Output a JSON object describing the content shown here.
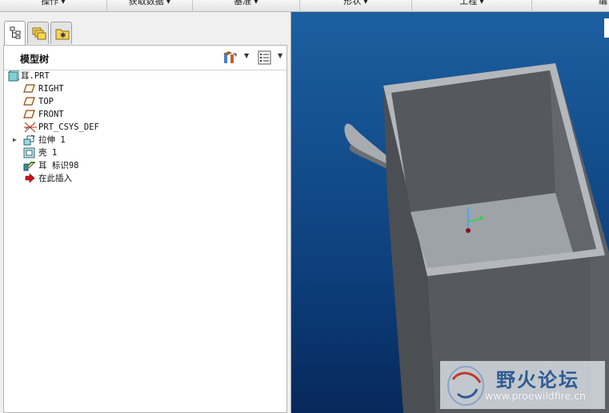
{
  "ribbon": {
    "groups": [
      {
        "label": "操作"
      },
      {
        "label": "获取数据"
      },
      {
        "label": "基准"
      },
      {
        "label": "形状"
      },
      {
        "label": "工程"
      },
      {
        "label": "编"
      }
    ]
  },
  "tabs": [
    {
      "icon": "model-tree-tab-icon",
      "active": true
    },
    {
      "icon": "layers-tab-icon",
      "active": false
    },
    {
      "icon": "folder-tab-icon",
      "active": false
    }
  ],
  "tree": {
    "title": "模型树",
    "settings_icon": "tree-settings-icon",
    "columns_icon": "tree-columns-icon",
    "items": [
      {
        "label": "耳.PRT",
        "icon": "part-icon"
      },
      {
        "label": "RIGHT",
        "icon": "datum-plane-icon"
      },
      {
        "label": "TOP",
        "icon": "datum-plane-icon"
      },
      {
        "label": "FRONT",
        "icon": "datum-plane-icon"
      },
      {
        "label": "PRT_CSYS_DEF",
        "icon": "csys-icon"
      },
      {
        "label": "拉伸 1",
        "icon": "extrude-icon"
      },
      {
        "label": "壳 1",
        "icon": "shell-icon"
      },
      {
        "label": "耳 标识98",
        "icon": "ear-feature-icon"
      },
      {
        "label": "在此插入",
        "icon": "insert-here-arrow-icon"
      }
    ]
  },
  "watermark": {
    "title": "野火论坛",
    "url": "www.proewildfire.cn"
  },
  "colors": {
    "viewport_top": "#1c5fa0",
    "viewport_bottom": "#07285a",
    "model_gray": "#5b5e63",
    "model_inner_floor": "#9ea3a7"
  }
}
